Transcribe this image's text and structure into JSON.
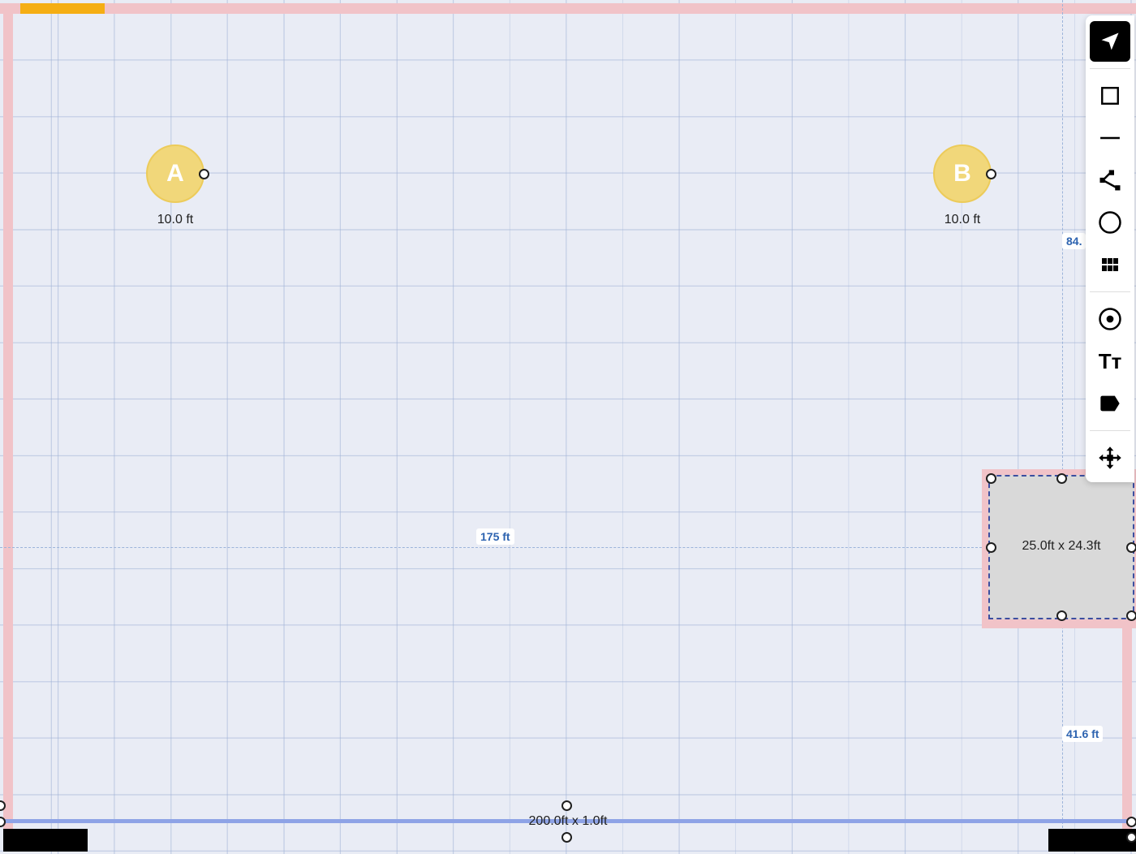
{
  "canvas": {
    "zones": [
      {
        "letter": "A",
        "size_label": "10.0 ft"
      },
      {
        "letter": "B",
        "size_label": "10.0 ft"
      }
    ],
    "dimensions": {
      "horizontal_label": "175 ft",
      "vertical_top_label": "84.",
      "vertical_bottom_label": "41.6 ft"
    },
    "selected_rect": {
      "label": "25.0ft x 24.3ft"
    },
    "wall": {
      "label": "200.0ft x 1.0ft"
    }
  },
  "toolbar": {
    "tools": [
      {
        "name": "select",
        "icon": "navigation-arrow-icon",
        "active": true
      },
      {
        "name": "rectangle",
        "icon": "square-icon"
      },
      {
        "name": "line",
        "icon": "line-icon"
      },
      {
        "name": "polyline",
        "icon": "polyline-icon"
      },
      {
        "name": "circle",
        "icon": "circle-icon"
      },
      {
        "name": "grid",
        "icon": "grid-icon"
      },
      {
        "name": "point",
        "icon": "target-icon"
      },
      {
        "name": "text",
        "icon": "text-icon",
        "glyph": "Tт"
      },
      {
        "name": "label",
        "icon": "tag-icon"
      },
      {
        "name": "pan",
        "icon": "move-arrows-icon"
      }
    ]
  },
  "colors": {
    "grid_bg": "#e9ecf5",
    "boundary": "#f1c3c8",
    "zone_fill": "#f1d77a",
    "dimension_text": "#2d63b0",
    "wall_line": "#8ea3e6",
    "accent_marker": "#f5ae14"
  }
}
